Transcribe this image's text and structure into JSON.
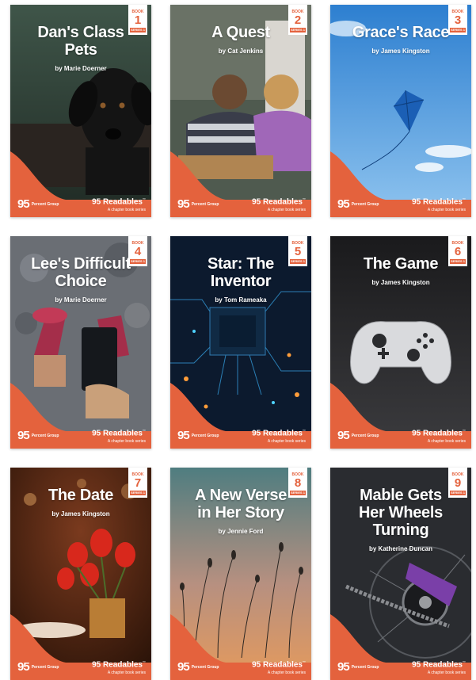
{
  "series": {
    "book_label": "BOOK",
    "series_label": "SERIES 1",
    "logo_text": "95",
    "logo_caption": "Percent Group",
    "brand": "95 Readables",
    "brand_mark": "™",
    "tagline": "A chapter book series",
    "accent_color": "#e4623d"
  },
  "books": [
    {
      "number": "1",
      "title": "Dan's Class Pets",
      "author": "by Marie Doerner",
      "scene": "black-dog"
    },
    {
      "number": "2",
      "title": "A Quest",
      "author": "by Cat Jenkins",
      "scene": "classroom-kids"
    },
    {
      "number": "3",
      "title": "Grace's Race",
      "author": "by James Kingston",
      "scene": "blue-kite-sky"
    },
    {
      "number": "4",
      "title": "Lee's Difficult Choice",
      "author": "by Marie Doerner",
      "scene": "sneakers-phone"
    },
    {
      "number": "5",
      "title": "Star: The Inventor",
      "author": "by Tom Rameaka",
      "scene": "circuit-board"
    },
    {
      "number": "6",
      "title": "The Game",
      "author": "by James Kingston",
      "scene": "game-controller"
    },
    {
      "number": "7",
      "title": "The Date",
      "author": "by James Kingston",
      "scene": "red-tulips"
    },
    {
      "number": "8",
      "title": "A New Verse in Her Story",
      "author": "by Jennie Ford",
      "scene": "grass-sunset"
    },
    {
      "number": "9",
      "title": "Mable Gets Her Wheels Turning",
      "author": "by Katherine Duncan",
      "scene": "bicycle-chain"
    }
  ]
}
